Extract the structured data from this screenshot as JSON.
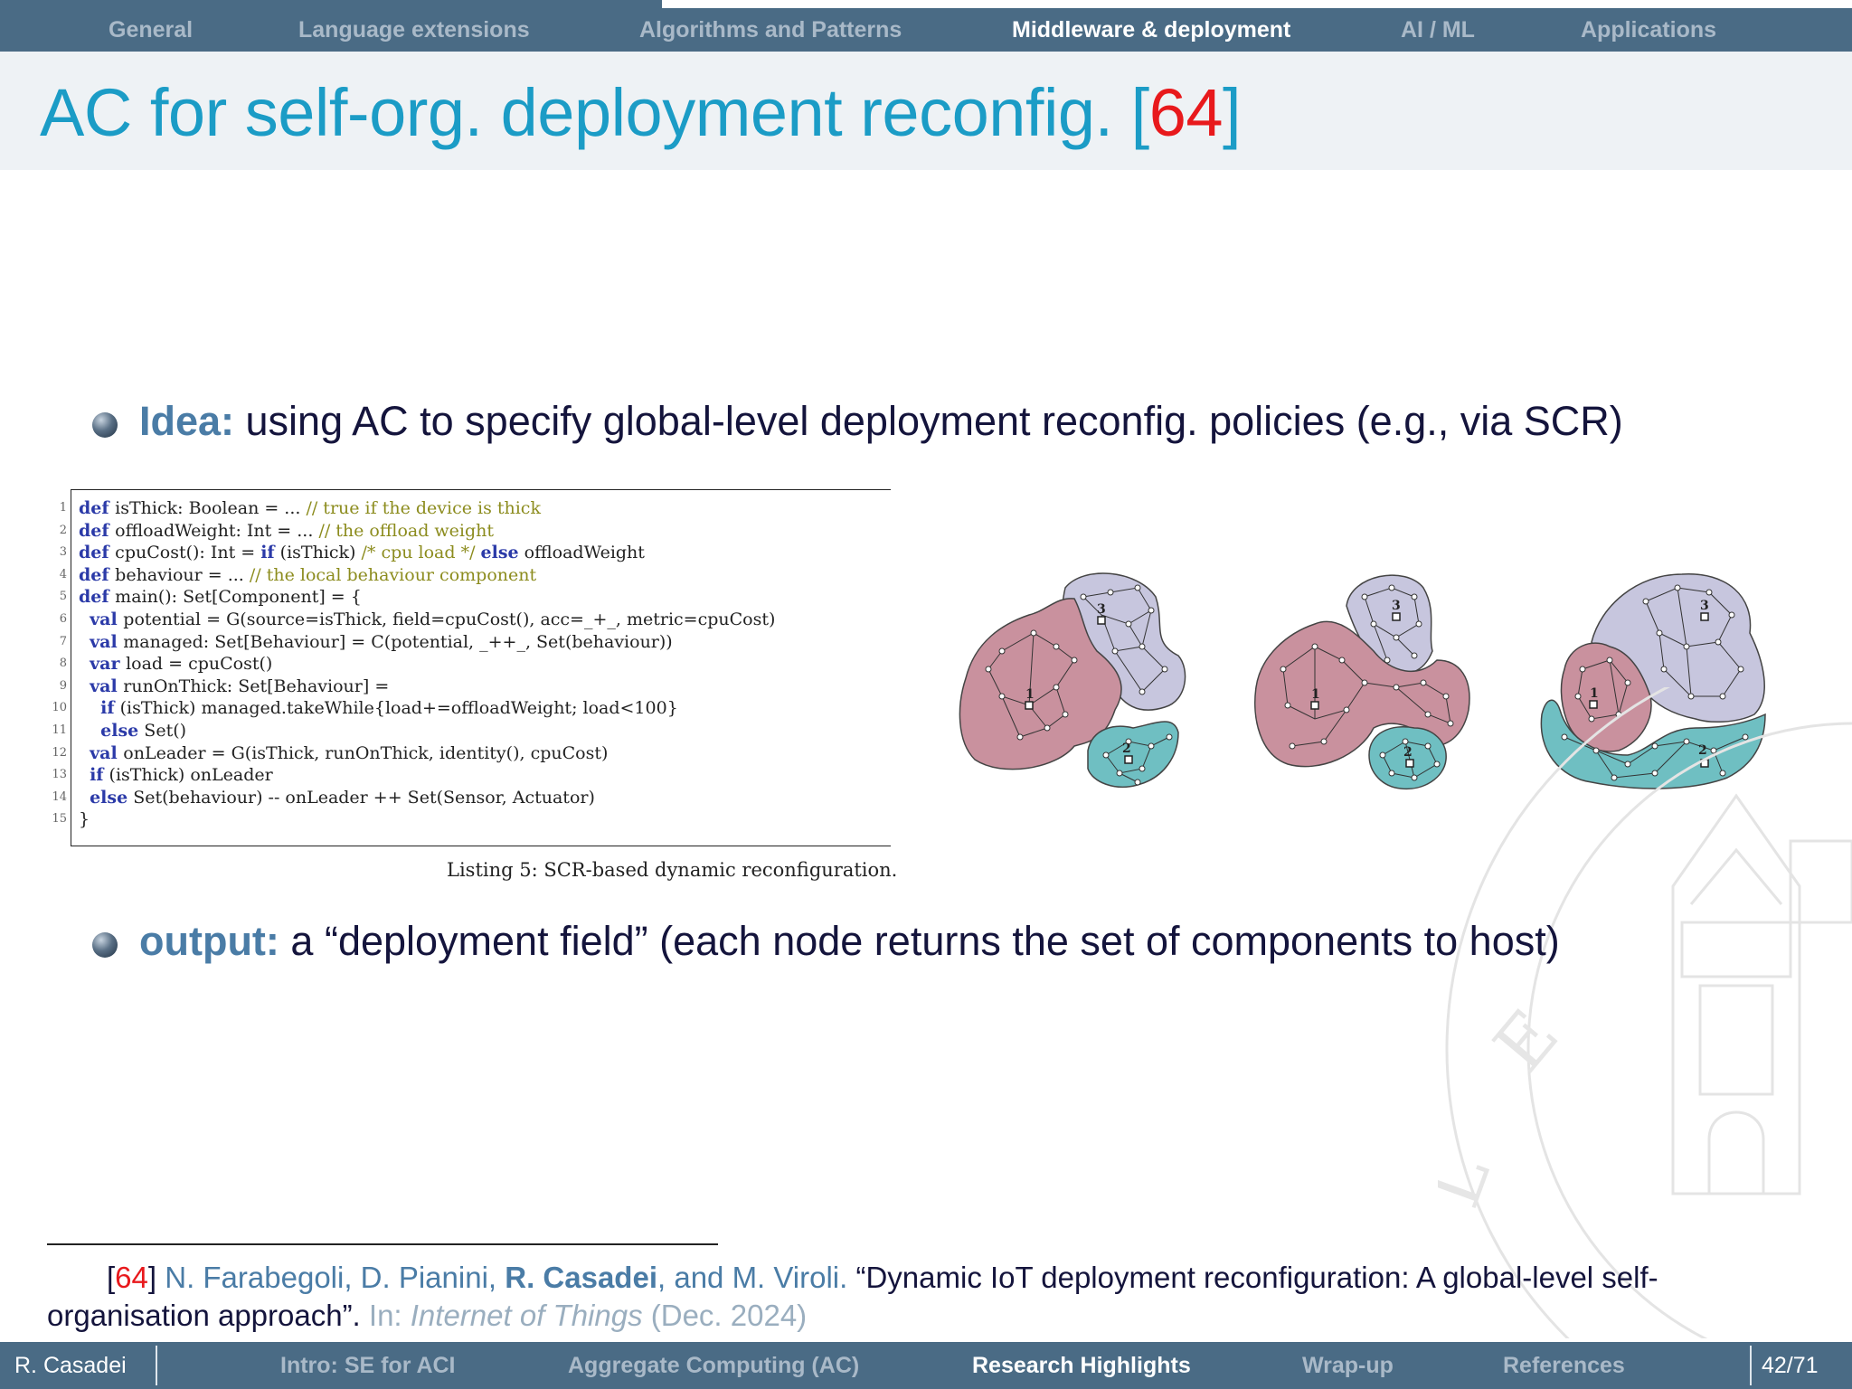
{
  "top_nav": {
    "sections": [
      "General",
      "Language extensions",
      "Algorithms and Patterns",
      "Middleware & deployment",
      "AI / ML",
      "Applications"
    ],
    "active_index": 3,
    "progress": 0.6
  },
  "slide": {
    "title": "AC for self-org. deployment reconfig. [",
    "title_ref": "64",
    "title_close": "]"
  },
  "bullets": [
    {
      "keyword": "Idea:",
      "text": " using AC to specify global-level deployment reconfig. policies (e.g., via SCR)"
    },
    {
      "keyword": "output:",
      "text": " a “deployment field” (each node returns the set of components to host)"
    }
  ],
  "listing": {
    "line_numbers": [
      "1",
      "2",
      "3",
      "4",
      "5",
      "6",
      "7",
      "8",
      "9",
      "10",
      "11",
      "12",
      "13",
      "14",
      "15"
    ],
    "caption": "Listing 5: SCR-based dynamic reconfiguration.",
    "lines": [
      {
        "indent": "",
        "parts": [
          [
            "kwd",
            "def"
          ],
          [
            "",
            "isThick: Boolean = ... "
          ],
          [
            "cmt",
            "// true if the device is thick"
          ]
        ]
      },
      {
        "indent": "",
        "parts": [
          [
            "kwd",
            "def"
          ],
          [
            "",
            "offloadWeight: Int = ... "
          ],
          [
            "cmt",
            "// the offload weight"
          ]
        ]
      },
      {
        "indent": "",
        "parts": [
          [
            "kwd",
            "def"
          ],
          [
            "",
            "cpuCost(): Int = "
          ],
          [
            "kwd",
            "if"
          ],
          [
            "",
            " (isThick) "
          ],
          [
            "cmt",
            "/* cpu load */"
          ],
          [
            "",
            " "
          ],
          [
            "kwd",
            "else"
          ],
          [
            "",
            " offloadWeight"
          ]
        ]
      },
      {
        "indent": "",
        "parts": [
          [
            "kwd",
            "def"
          ],
          [
            "",
            "behaviour = ... "
          ],
          [
            "cmt",
            "// the local behaviour component"
          ]
        ]
      },
      {
        "indent": "",
        "parts": [
          [
            "kwd",
            "def"
          ],
          [
            "",
            "main(): Set[Component] = {"
          ]
        ]
      },
      {
        "indent": "  ",
        "parts": [
          [
            "kwd",
            "val"
          ],
          [
            "",
            "potential = G(source=isThick, field=cpuCost(), acc=_+_, metric=cpuCost)"
          ]
        ]
      },
      {
        "indent": "  ",
        "parts": [
          [
            "kwd",
            "val"
          ],
          [
            "",
            "managed: Set[Behaviour] = C(potential, _++_, Set(behaviour))"
          ]
        ]
      },
      {
        "indent": "  ",
        "parts": [
          [
            "kwd",
            "var"
          ],
          [
            "",
            "load = cpuCost()"
          ]
        ]
      },
      {
        "indent": "  ",
        "parts": [
          [
            "kwd",
            "val"
          ],
          [
            "",
            "runOnThick: Set[Behaviour] ="
          ]
        ]
      },
      {
        "indent": "    ",
        "parts": [
          [
            "kwd",
            "if"
          ],
          [
            "",
            " (isThick) managed.takeWhile{load+=offloadWeight; load<100}"
          ]
        ]
      },
      {
        "indent": "    ",
        "parts": [
          [
            "kwd",
            "else"
          ],
          [
            "",
            " Set()"
          ]
        ]
      },
      {
        "indent": "  ",
        "parts": [
          [
            "kwd",
            "val"
          ],
          [
            "",
            "onLeader = G(isThick, runOnThick, identity(), cpuCost)"
          ]
        ]
      },
      {
        "indent": "  ",
        "parts": [
          [
            "kwd",
            "if"
          ],
          [
            "",
            " (isThick) onLeader"
          ]
        ]
      },
      {
        "indent": "  ",
        "parts": [
          [
            "kwd",
            "else"
          ],
          [
            "",
            " Set(behaviour) -- onLeader ++ Set(Sensor, Actuator)"
          ]
        ]
      },
      {
        "indent": "",
        "parts": [
          [
            "",
            "}"
          ]
        ]
      }
    ]
  },
  "diagrams": {
    "labels": [
      "1",
      "2",
      "3"
    ],
    "colors": {
      "region1": "#c9919e",
      "region2": "#6fbfc2",
      "region3": "#cdcbe0"
    }
  },
  "footnote": {
    "ref": "64",
    "authors_pre": "N. Farabegoli, D. Pianini, ",
    "author_bold": "R. Casadei",
    "authors_post": ", and M. Viroli.",
    "title": " “Dynamic IoT deployment reconfiguration: A global-level self-organisation approach”.",
    "in_label": " In: ",
    "venue": "Internet of Things",
    "date": " (Dec. 2024)"
  },
  "bottom_nav": {
    "author": "R. Casadei",
    "sections": [
      "Intro: SE for ACI",
      "Aggregate Computing (AC)",
      "Research Highlights",
      "Wrap-up",
      "References"
    ],
    "active_index": 2,
    "page": "42/71"
  },
  "theme": {
    "bar": "#4a6b85",
    "title": "#1b9cc6",
    "ref": "#e8191c",
    "keyword": "#4a7ca6"
  }
}
